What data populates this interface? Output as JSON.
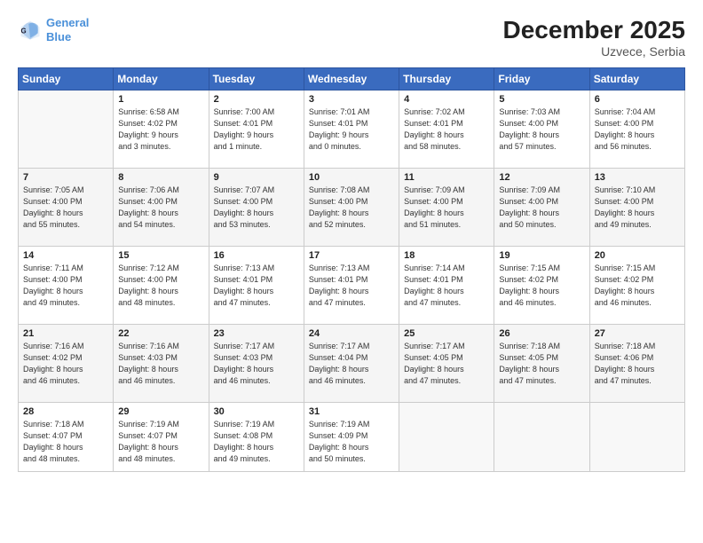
{
  "logo": {
    "line1": "General",
    "line2": "Blue"
  },
  "title": "December 2025",
  "subtitle": "Uzvece, Serbia",
  "days_header": [
    "Sunday",
    "Monday",
    "Tuesday",
    "Wednesday",
    "Thursday",
    "Friday",
    "Saturday"
  ],
  "weeks": [
    [
      {
        "num": "",
        "info": ""
      },
      {
        "num": "1",
        "info": "Sunrise: 6:58 AM\nSunset: 4:02 PM\nDaylight: 9 hours\nand 3 minutes."
      },
      {
        "num": "2",
        "info": "Sunrise: 7:00 AM\nSunset: 4:01 PM\nDaylight: 9 hours\nand 1 minute."
      },
      {
        "num": "3",
        "info": "Sunrise: 7:01 AM\nSunset: 4:01 PM\nDaylight: 9 hours\nand 0 minutes."
      },
      {
        "num": "4",
        "info": "Sunrise: 7:02 AM\nSunset: 4:01 PM\nDaylight: 8 hours\nand 58 minutes."
      },
      {
        "num": "5",
        "info": "Sunrise: 7:03 AM\nSunset: 4:00 PM\nDaylight: 8 hours\nand 57 minutes."
      },
      {
        "num": "6",
        "info": "Sunrise: 7:04 AM\nSunset: 4:00 PM\nDaylight: 8 hours\nand 56 minutes."
      }
    ],
    [
      {
        "num": "7",
        "info": "Sunrise: 7:05 AM\nSunset: 4:00 PM\nDaylight: 8 hours\nand 55 minutes."
      },
      {
        "num": "8",
        "info": "Sunrise: 7:06 AM\nSunset: 4:00 PM\nDaylight: 8 hours\nand 54 minutes."
      },
      {
        "num": "9",
        "info": "Sunrise: 7:07 AM\nSunset: 4:00 PM\nDaylight: 8 hours\nand 53 minutes."
      },
      {
        "num": "10",
        "info": "Sunrise: 7:08 AM\nSunset: 4:00 PM\nDaylight: 8 hours\nand 52 minutes."
      },
      {
        "num": "11",
        "info": "Sunrise: 7:09 AM\nSunset: 4:00 PM\nDaylight: 8 hours\nand 51 minutes."
      },
      {
        "num": "12",
        "info": "Sunrise: 7:09 AM\nSunset: 4:00 PM\nDaylight: 8 hours\nand 50 minutes."
      },
      {
        "num": "13",
        "info": "Sunrise: 7:10 AM\nSunset: 4:00 PM\nDaylight: 8 hours\nand 49 minutes."
      }
    ],
    [
      {
        "num": "14",
        "info": "Sunrise: 7:11 AM\nSunset: 4:00 PM\nDaylight: 8 hours\nand 49 minutes."
      },
      {
        "num": "15",
        "info": "Sunrise: 7:12 AM\nSunset: 4:00 PM\nDaylight: 8 hours\nand 48 minutes."
      },
      {
        "num": "16",
        "info": "Sunrise: 7:13 AM\nSunset: 4:01 PM\nDaylight: 8 hours\nand 47 minutes."
      },
      {
        "num": "17",
        "info": "Sunrise: 7:13 AM\nSunset: 4:01 PM\nDaylight: 8 hours\nand 47 minutes."
      },
      {
        "num": "18",
        "info": "Sunrise: 7:14 AM\nSunset: 4:01 PM\nDaylight: 8 hours\nand 47 minutes."
      },
      {
        "num": "19",
        "info": "Sunrise: 7:15 AM\nSunset: 4:02 PM\nDaylight: 8 hours\nand 46 minutes."
      },
      {
        "num": "20",
        "info": "Sunrise: 7:15 AM\nSunset: 4:02 PM\nDaylight: 8 hours\nand 46 minutes."
      }
    ],
    [
      {
        "num": "21",
        "info": "Sunrise: 7:16 AM\nSunset: 4:02 PM\nDaylight: 8 hours\nand 46 minutes."
      },
      {
        "num": "22",
        "info": "Sunrise: 7:16 AM\nSunset: 4:03 PM\nDaylight: 8 hours\nand 46 minutes."
      },
      {
        "num": "23",
        "info": "Sunrise: 7:17 AM\nSunset: 4:03 PM\nDaylight: 8 hours\nand 46 minutes."
      },
      {
        "num": "24",
        "info": "Sunrise: 7:17 AM\nSunset: 4:04 PM\nDaylight: 8 hours\nand 46 minutes."
      },
      {
        "num": "25",
        "info": "Sunrise: 7:17 AM\nSunset: 4:05 PM\nDaylight: 8 hours\nand 47 minutes."
      },
      {
        "num": "26",
        "info": "Sunrise: 7:18 AM\nSunset: 4:05 PM\nDaylight: 8 hours\nand 47 minutes."
      },
      {
        "num": "27",
        "info": "Sunrise: 7:18 AM\nSunset: 4:06 PM\nDaylight: 8 hours\nand 47 minutes."
      }
    ],
    [
      {
        "num": "28",
        "info": "Sunrise: 7:18 AM\nSunset: 4:07 PM\nDaylight: 8 hours\nand 48 minutes."
      },
      {
        "num": "29",
        "info": "Sunrise: 7:19 AM\nSunset: 4:07 PM\nDaylight: 8 hours\nand 48 minutes."
      },
      {
        "num": "30",
        "info": "Sunrise: 7:19 AM\nSunset: 4:08 PM\nDaylight: 8 hours\nand 49 minutes."
      },
      {
        "num": "31",
        "info": "Sunrise: 7:19 AM\nSunset: 4:09 PM\nDaylight: 8 hours\nand 50 minutes."
      },
      {
        "num": "",
        "info": ""
      },
      {
        "num": "",
        "info": ""
      },
      {
        "num": "",
        "info": ""
      }
    ]
  ]
}
